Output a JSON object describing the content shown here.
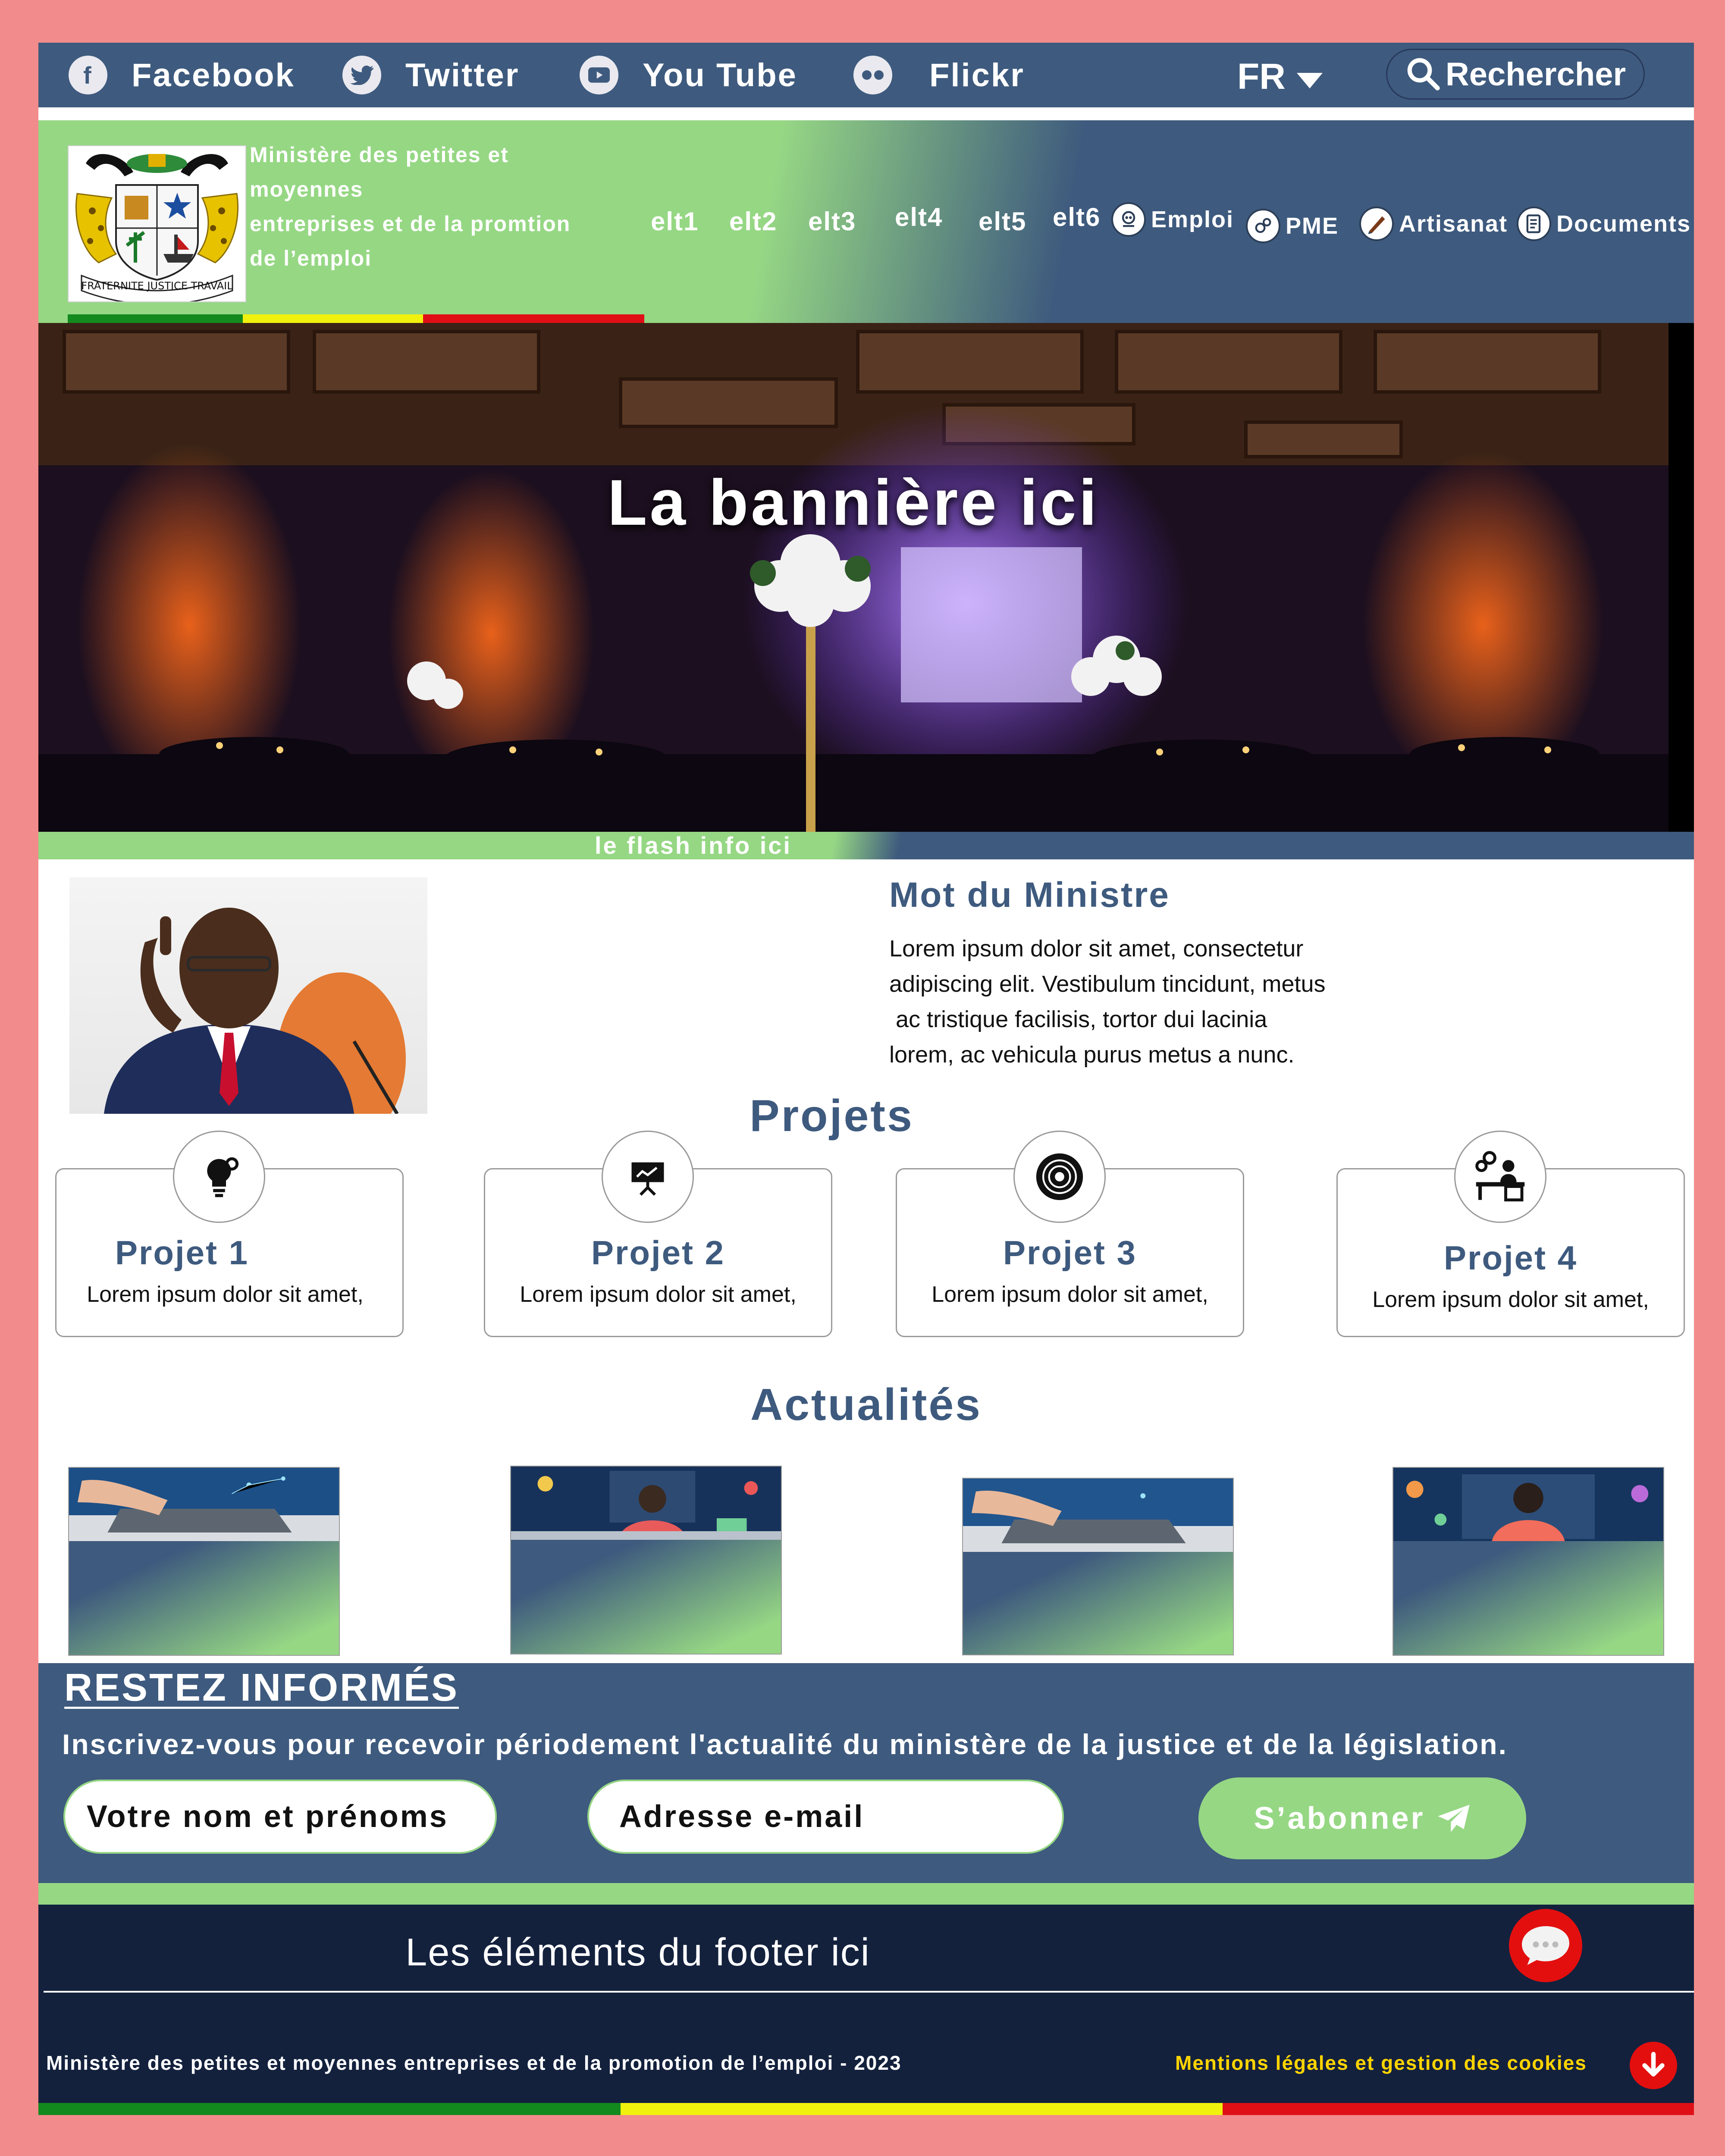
{
  "colors": {
    "primary": "#3e5a7e",
    "accent": "#96d784",
    "footer": "#13213d",
    "frame": "#f28b8b",
    "flag_green": "#138a1e",
    "flag_yellow": "#f1f10e",
    "flag_red": "#e00f16",
    "alert": "#e30f0f",
    "legal": "#ffd400"
  },
  "topbar": {
    "social": [
      {
        "label": "Facebook",
        "icon": "facebook-icon"
      },
      {
        "label": "Twitter",
        "icon": "twitter-icon"
      },
      {
        "label": "You Tube",
        "icon": "youtube-icon"
      },
      {
        "label": "Flickr",
        "icon": "flickr-icon"
      }
    ],
    "language": "FR",
    "search_label": "Rechercher"
  },
  "header": {
    "ministry_lines": [
      "Ministère des petites et",
      "moyennes",
      "entreprises et de la promtion",
      "de l’emploi"
    ],
    "emblem_motto": "FRATERNITE JUSTICE TRAVAIL",
    "nav": [
      "elt1",
      "elt2",
      "elt3",
      "elt4",
      "elt5",
      "elt6"
    ],
    "nav_icons": [
      {
        "label": "Emploi",
        "icon": "employment-icon"
      },
      {
        "label": "PME",
        "icon": "gears-icon"
      },
      {
        "label": "Artisanat",
        "icon": "craft-icon"
      },
      {
        "label": "Documents",
        "icon": "document-icon"
      }
    ]
  },
  "banner": {
    "title": "La bannière ici",
    "flash": "le flash info ici"
  },
  "minister": {
    "title": "Mot du Ministre",
    "lines": [
      "Lorem ipsum dolor sit amet, consectetur",
      "adipiscing elit. Vestibulum tincidunt, metus",
      " ac tristique facilisis, tortor dui lacinia",
      "lorem, ac vehicula purus metus a nunc."
    ]
  },
  "projects": {
    "title": "Projets",
    "items": [
      {
        "title": "Projet 1",
        "text": "Lorem ipsum dolor sit amet,",
        "icon": "idea-gear-icon"
      },
      {
        "title": "Projet 2",
        "text": "Lorem ipsum dolor sit amet,",
        "icon": "presentation-icon"
      },
      {
        "title": "Projet 3",
        "text": "Lorem ipsum dolor sit amet,",
        "icon": "target-icon"
      },
      {
        "title": "Projet 4",
        "text": "Lorem ipsum dolor sit amet,",
        "icon": "business-desk-icon"
      }
    ]
  },
  "news": {
    "title": "Actualités",
    "items": [
      {
        "image": "laptop-hands-image"
      },
      {
        "image": "developer-desk-image"
      },
      {
        "image": "laptop-hands-image"
      },
      {
        "image": "coder-screen-image"
      }
    ]
  },
  "newsletter": {
    "title": "RESTEZ INFORMÉS",
    "description": "Inscrivez-vous pour recevoir périodement l'actualité du ministère de la justice et de la législation.",
    "name_placeholder": "Votre nom et prénoms",
    "email_placeholder": "Adresse e-mail",
    "subscribe_label": "S’abonner"
  },
  "footer": {
    "elements": "Les éléments du footer ici",
    "copyright": "Ministère des petites et moyennes entreprises et de la promotion de l’emploi - 2023",
    "legal": "Mentions légales et gestion des cookies"
  }
}
